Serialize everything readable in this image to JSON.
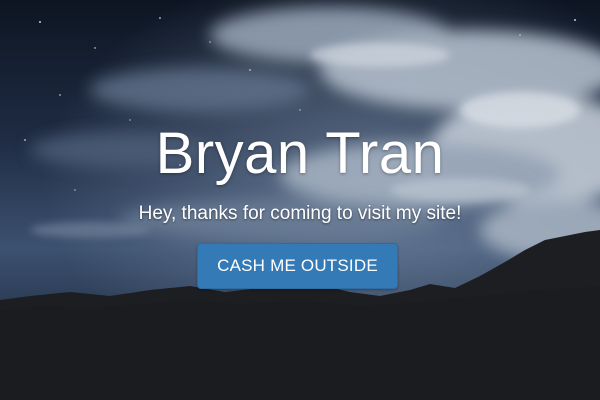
{
  "hero": {
    "title": "Bryan Tran",
    "subtitle": "Hey, thanks for coming to visit my site!",
    "cta_label": "CASH ME OUTSIDE"
  },
  "background": {
    "description_icon": "night-sky-mountains-image"
  },
  "colors": {
    "cta_background": "#337ab7",
    "cta_border": "#2e6da4",
    "text": "#ffffff",
    "sky_top": "#0f1726",
    "sky_mid": "#2c3d58",
    "mountains": "#1c1c1e"
  }
}
